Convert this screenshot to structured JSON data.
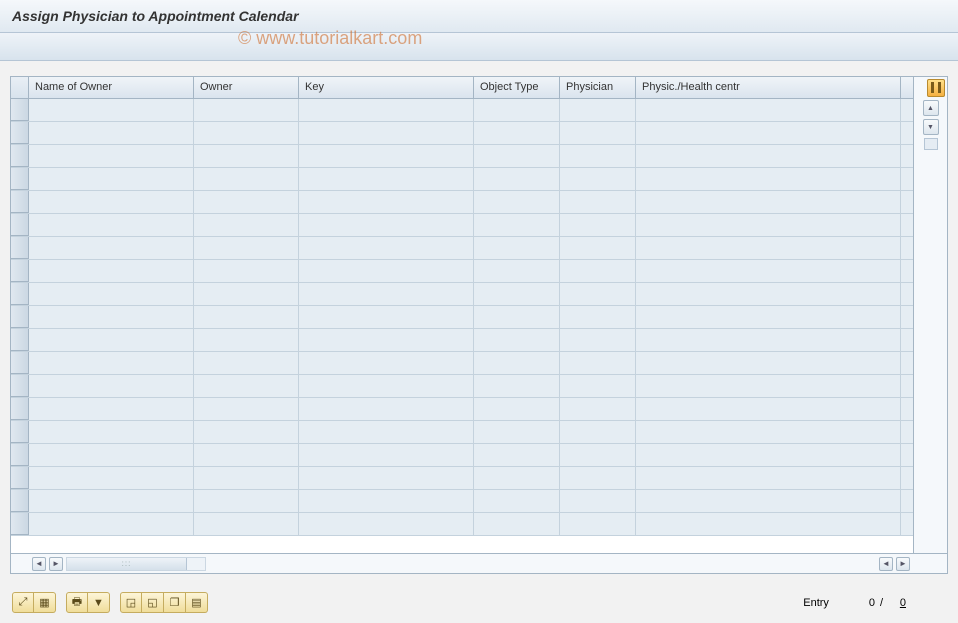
{
  "header": {
    "title": "Assign Physician to Appointment Calendar"
  },
  "watermark": "© www.tutorialkart.com",
  "table": {
    "columns": [
      {
        "label": "Name of Owner",
        "class": "col-name-owner"
      },
      {
        "label": "Owner",
        "class": "col-owner"
      },
      {
        "label": "Key",
        "class": "col-key"
      },
      {
        "label": "Object Type",
        "class": "col-object-type"
      },
      {
        "label": "Physician",
        "class": "col-physician"
      },
      {
        "label": "Physic./Health centr",
        "class": "col-health"
      }
    ],
    "row_count": 19
  },
  "footer": {
    "entry_label": "Entry",
    "entry_current": "0",
    "entry_separator": "/",
    "entry_total": "0"
  }
}
